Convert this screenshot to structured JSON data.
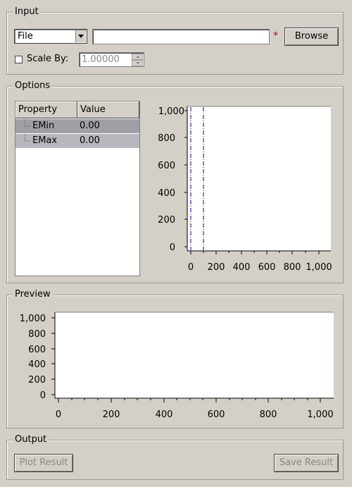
{
  "input": {
    "title": "Input",
    "source_combo": "File",
    "file_path_value": "",
    "required_marker": "*",
    "browse_label": "Browse",
    "scale_label": "Scale By:",
    "scale_checked": false,
    "scale_value": "1.00000"
  },
  "options": {
    "title": "Options",
    "table": {
      "headers": [
        "Property",
        "Value"
      ],
      "rows": [
        {
          "property": "EMin",
          "value": "0.00"
        },
        {
          "property": "EMax",
          "value": "0.00"
        }
      ]
    },
    "plot": {
      "y_ticks": [
        "1,000",
        "800",
        "600",
        "400",
        "200",
        "0"
      ],
      "x_ticks": [
        "0",
        "200",
        "400",
        "600",
        "800",
        "1,000"
      ]
    }
  },
  "preview": {
    "title": "Preview",
    "y_ticks": [
      "1,000",
      "800",
      "600",
      "400",
      "200",
      "0"
    ],
    "x_ticks": [
      "0",
      "200",
      "400",
      "600",
      "800",
      "1,000"
    ]
  },
  "output": {
    "title": "Output",
    "plot_label": "Plot Result",
    "save_label": "Save Result"
  },
  "colors": {
    "background": "#d4d0c8",
    "selected_row": "#a09fa5",
    "second_row": "#b8b7bd",
    "marker_line": "#000080",
    "required_marker": "#c00000"
  }
}
